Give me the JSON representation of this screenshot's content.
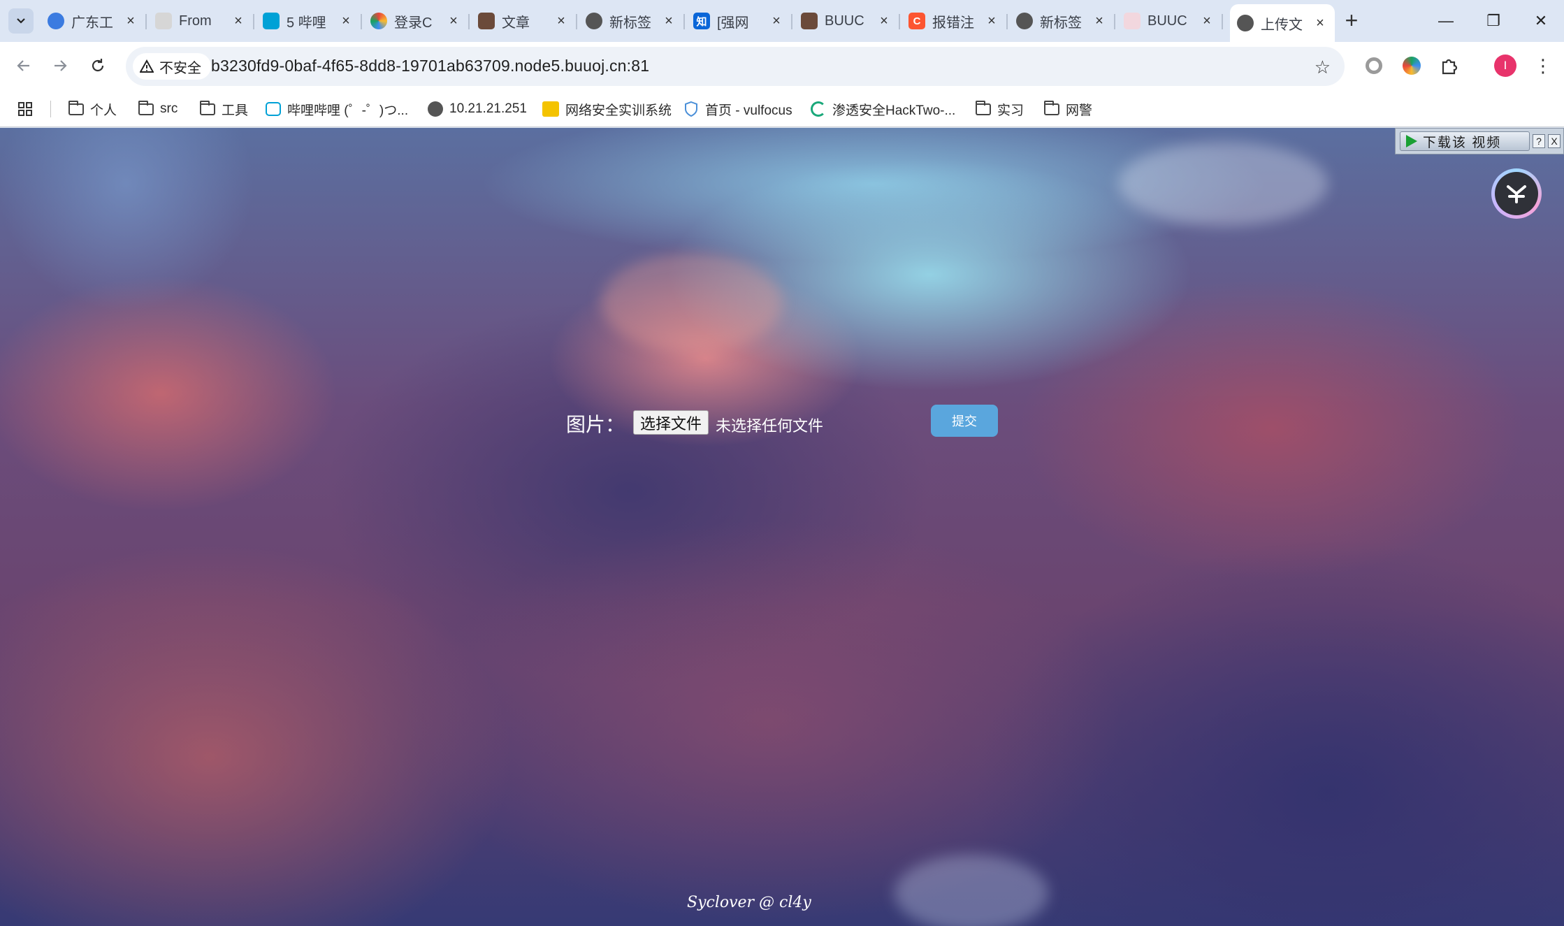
{
  "browser": {
    "tabs": [
      {
        "title": "广东工",
        "icon": "globe-blue-icon",
        "color": "#3b7be0"
      },
      {
        "title": "From",
        "icon": "page-icon",
        "color": "#bfbfbf"
      },
      {
        "title": "5 哔哩",
        "icon": "bilibili-icon",
        "color": "#00a1d6"
      },
      {
        "title": "登录C",
        "icon": "chrome-color-icon",
        "color": "#e8453c"
      },
      {
        "title": "文章",
        "icon": "image-icon",
        "color": "#6b4a3a"
      },
      {
        "title": "新标签",
        "icon": "chrome-icon",
        "color": "#555555"
      },
      {
        "title": "[强网",
        "icon": "zhihu-icon",
        "color": "#0a66d8",
        "glyph": "知"
      },
      {
        "title": "BUUC",
        "icon": "image-icon",
        "color": "#6b4a3a"
      },
      {
        "title": "报错注",
        "icon": "csdn-icon",
        "color": "#fc5531",
        "glyph": "C"
      },
      {
        "title": "新标签",
        "icon": "chrome-icon",
        "color": "#555555"
      },
      {
        "title": "BUUC",
        "icon": "buu-icon",
        "color": "#d23b5a"
      },
      {
        "title": "上传文",
        "icon": "globe-icon",
        "color": "#444444",
        "active": true
      }
    ],
    "new_tab": "+",
    "window_controls": {
      "minimize": "—",
      "restore": "❐",
      "close": "✕"
    },
    "address": {
      "security_label": "不安全",
      "url": "b3230fd9-0baf-4f65-8dd8-19701ab63709.node5.buuoj.cn:81"
    },
    "profile_initial": "I",
    "bookmarks": [
      {
        "label": "个人",
        "icon": "folder-icon"
      },
      {
        "label": "src",
        "icon": "folder-icon"
      },
      {
        "label": "工具",
        "icon": "folder-icon"
      },
      {
        "label": "哔哩哔哩 (゜-゜)つ...",
        "icon": "bilibili-icon"
      },
      {
        "label": "10.21.21.251",
        "icon": "globe-icon"
      },
      {
        "label": "网络安全实训系统",
        "icon": "training-icon"
      },
      {
        "label": "首页 - vulfocus",
        "icon": "shield-icon"
      },
      {
        "label": "渗透安全HackTwo-...",
        "icon": "loading-ring-icon"
      },
      {
        "label": "实习",
        "icon": "folder-icon"
      },
      {
        "label": "网警",
        "icon": "folder-icon"
      }
    ]
  },
  "page": {
    "upload_label": "图片：",
    "file_button": "选择文件",
    "file_status": "未选择任何文件",
    "submit_label": "提交",
    "footer": "Syclover @ cl4y",
    "download_widget": {
      "label": "下载该 视频",
      "help": "?",
      "close": "X"
    }
  },
  "colors": {
    "submit_bg": "#5aa6dd",
    "tab_strip_bg": "#dde6f4",
    "omnibox_bg": "#eef2f8"
  }
}
